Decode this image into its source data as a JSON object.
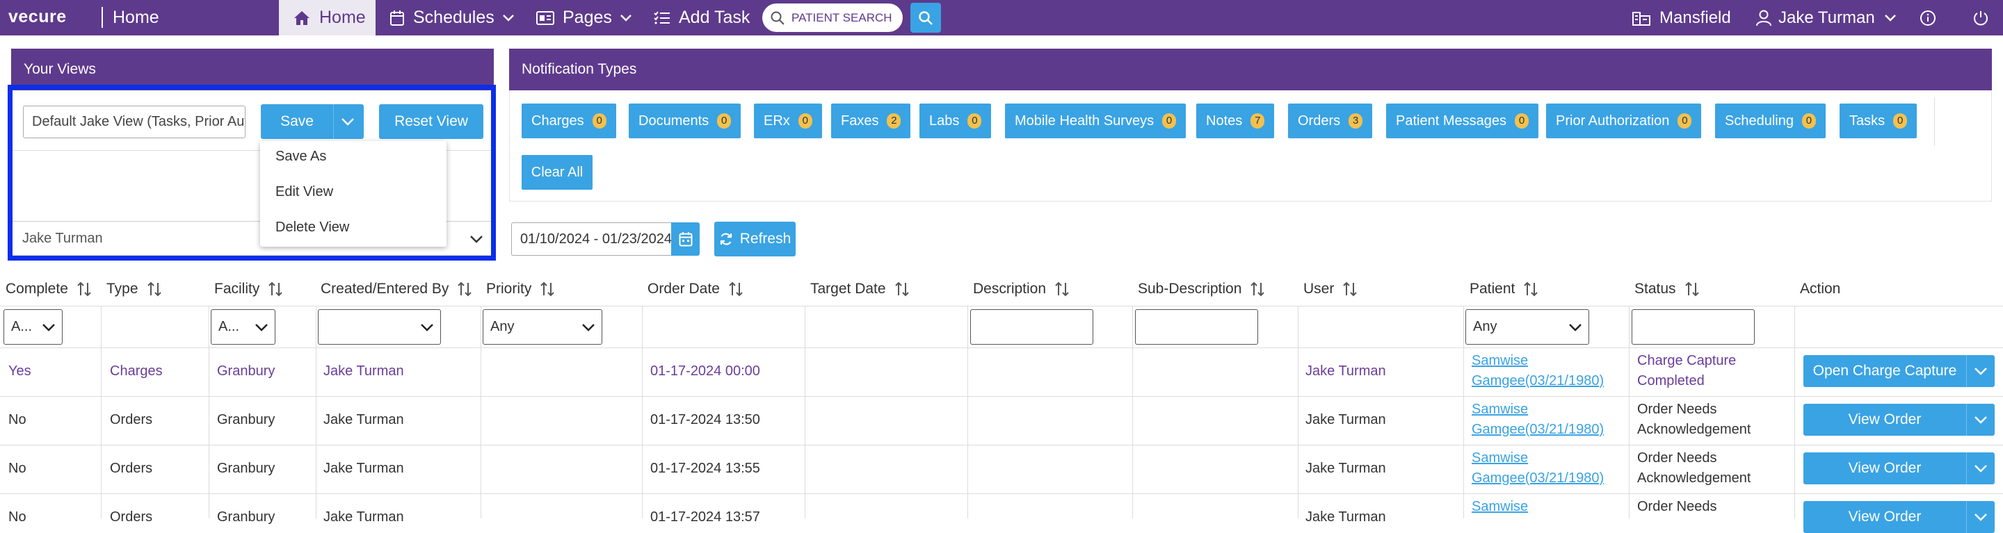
{
  "app": {
    "logo": "vecure",
    "title": "Home"
  },
  "nav": {
    "home": "Home",
    "schedules": "Schedules",
    "pages": "Pages",
    "add_task": "Add Task",
    "search_placeholder": "PATIENT SEARCH",
    "location": "Mansfield",
    "user": "Jake Turman"
  },
  "views": {
    "title": "Your Views",
    "current_view": "Default Jake View (Tasks, Prior Aut",
    "save_label": "Save",
    "reset_label": "Reset View",
    "user_value": "Jake Turman",
    "menu": [
      "Save As",
      "Edit View",
      "Delete View"
    ]
  },
  "notifications": {
    "title": "Notification Types",
    "types": [
      {
        "label": "Charges",
        "count": "0"
      },
      {
        "label": "Documents",
        "count": "0"
      },
      {
        "label": "ERx",
        "count": "0"
      },
      {
        "label": "Faxes",
        "count": "2"
      },
      {
        "label": "Labs",
        "count": "0"
      },
      {
        "label": "Mobile Health Surveys",
        "count": "0"
      },
      {
        "label": "Notes",
        "count": "7"
      },
      {
        "label": "Orders",
        "count": "3"
      },
      {
        "label": "Patient Messages",
        "count": "0"
      },
      {
        "label": "Prior Authorization",
        "count": "0"
      },
      {
        "label": "Scheduling",
        "count": "0"
      },
      {
        "label": "Tasks",
        "count": "0"
      }
    ],
    "clear_all": "Clear All"
  },
  "date_range": "01/10/2024 - 01/23/2024",
  "refresh_label": "Refresh",
  "table": {
    "columns": [
      "Complete",
      "Type",
      "Facility",
      "Created/Entered By",
      "Priority",
      "Order Date",
      "Target Date",
      "Description",
      "Sub-Description",
      "User",
      "Patient",
      "Status",
      "Action"
    ],
    "filters": {
      "complete": "A...",
      "facility": "A...",
      "created_by": "",
      "priority": "Any",
      "patient": "Any"
    },
    "rows": [
      {
        "complete": "Yes",
        "type": "Charges",
        "facility": "Granbury",
        "created_by": "Jake Turman",
        "order_date": "01-17-2024 00:00",
        "user": "Jake Turman",
        "patient_1": "Samwise",
        "patient_2": "Gamgee(03/21/1980)",
        "status_1": "Charge Capture",
        "status_2": "Completed",
        "action": "Open Charge Capture"
      },
      {
        "complete": "No",
        "type": "Orders",
        "facility": "Granbury",
        "created_by": "Jake Turman",
        "order_date": "01-17-2024 13:50",
        "user": "Jake Turman",
        "patient_1": "Samwise",
        "patient_2": "Gamgee(03/21/1980)",
        "status_1": "Order Needs",
        "status_2": "Acknowledgement",
        "action": "View Order"
      },
      {
        "complete": "No",
        "type": "Orders",
        "facility": "Granbury",
        "created_by": "Jake Turman",
        "order_date": "01-17-2024 13:55",
        "user": "Jake Turman",
        "patient_1": "Samwise",
        "patient_2": "Gamgee(03/21/1980)",
        "status_1": "Order Needs",
        "status_2": "Acknowledgement",
        "action": "View Order"
      },
      {
        "complete": "No",
        "type": "Orders",
        "facility": "Granbury",
        "created_by": "Jake Turman",
        "order_date": "01-17-2024 13:57",
        "user": "Jake Turman",
        "patient_1": "Samwise",
        "patient_2": "",
        "status_1": "Order Needs",
        "status_2": "",
        "action": "View Order"
      }
    ]
  },
  "colors": {
    "brand": "#5e3a8c",
    "accent": "#3aa3e3",
    "badge": "#f2c14e",
    "highlight": "#0a2eea"
  }
}
